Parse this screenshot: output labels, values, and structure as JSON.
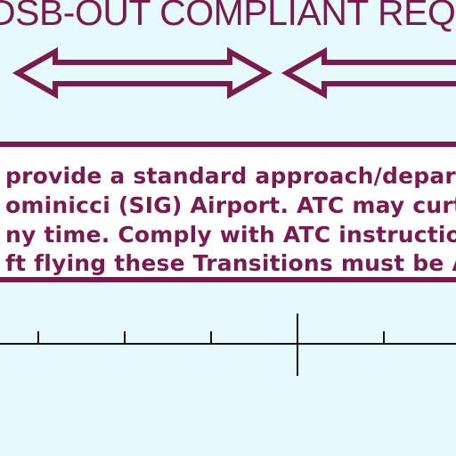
{
  "heading": {
    "text": "DSB-OUT COMPLIANT REQ"
  },
  "notice": {
    "lines": [
      "provide a standard approach/departu",
      "ominicci (SIG) Airport. ATC may curtai",
      "ny time. Comply with ATC instructions",
      "ft flying these Transitions must be ADS"
    ]
  },
  "colors": {
    "background": "#e6f9fd",
    "accent": "#7a1a4e",
    "box_fill": "#ffffff",
    "scale_line": "#111111"
  }
}
